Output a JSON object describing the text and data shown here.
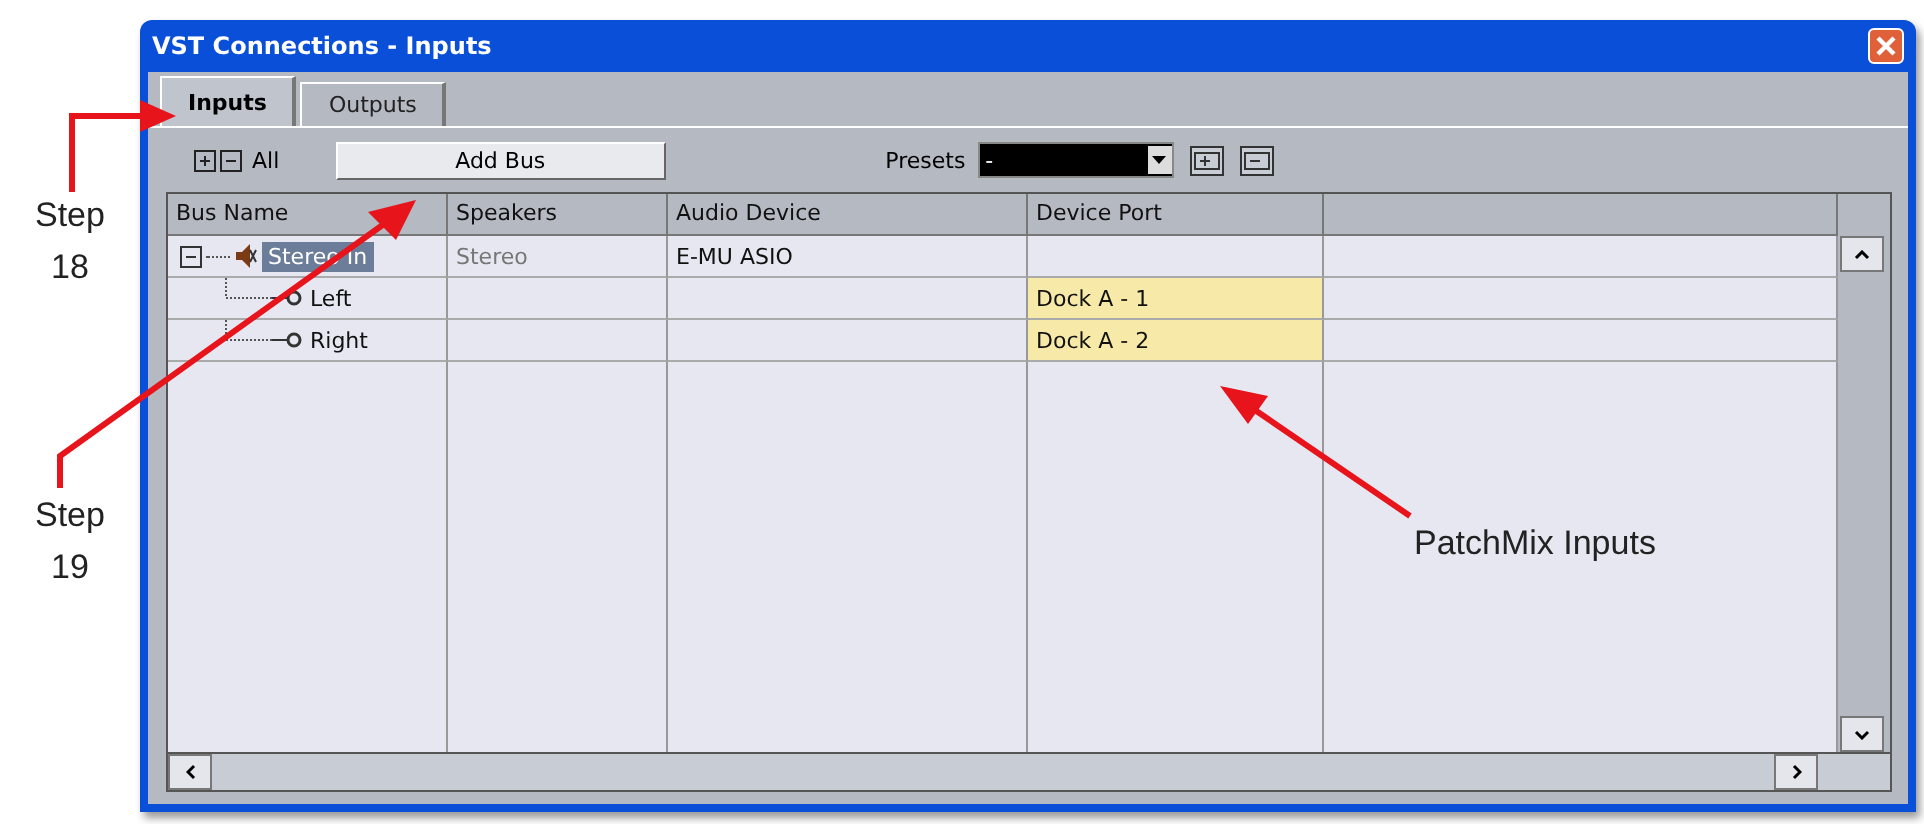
{
  "window": {
    "title": "VST Connections - Inputs"
  },
  "tabs": [
    {
      "label": "Inputs",
      "selected": true
    },
    {
      "label": "Outputs",
      "selected": false
    }
  ],
  "toolbar": {
    "all_label": "All",
    "add_button": "Add Bus",
    "presets_label": "Presets",
    "presets_value": "-"
  },
  "table": {
    "columns": [
      "Bus Name",
      "Speakers",
      "Audio Device",
      "Device Port"
    ],
    "rows": [
      {
        "name": "Stereo In",
        "expanded": true,
        "selected": true,
        "speakers": "Stereo",
        "audio_device": "E-MU ASIO",
        "device_port": "",
        "children": [
          {
            "name": "Left",
            "device_port": "Dock A - 1",
            "highlighted": true
          },
          {
            "name": "Right",
            "device_port": "Dock A - 2",
            "highlighted": true
          }
        ]
      }
    ]
  },
  "annotations": [
    {
      "text": "Step 18"
    },
    {
      "text": "Step 19"
    },
    {
      "text": "PatchMix Inputs"
    }
  ]
}
